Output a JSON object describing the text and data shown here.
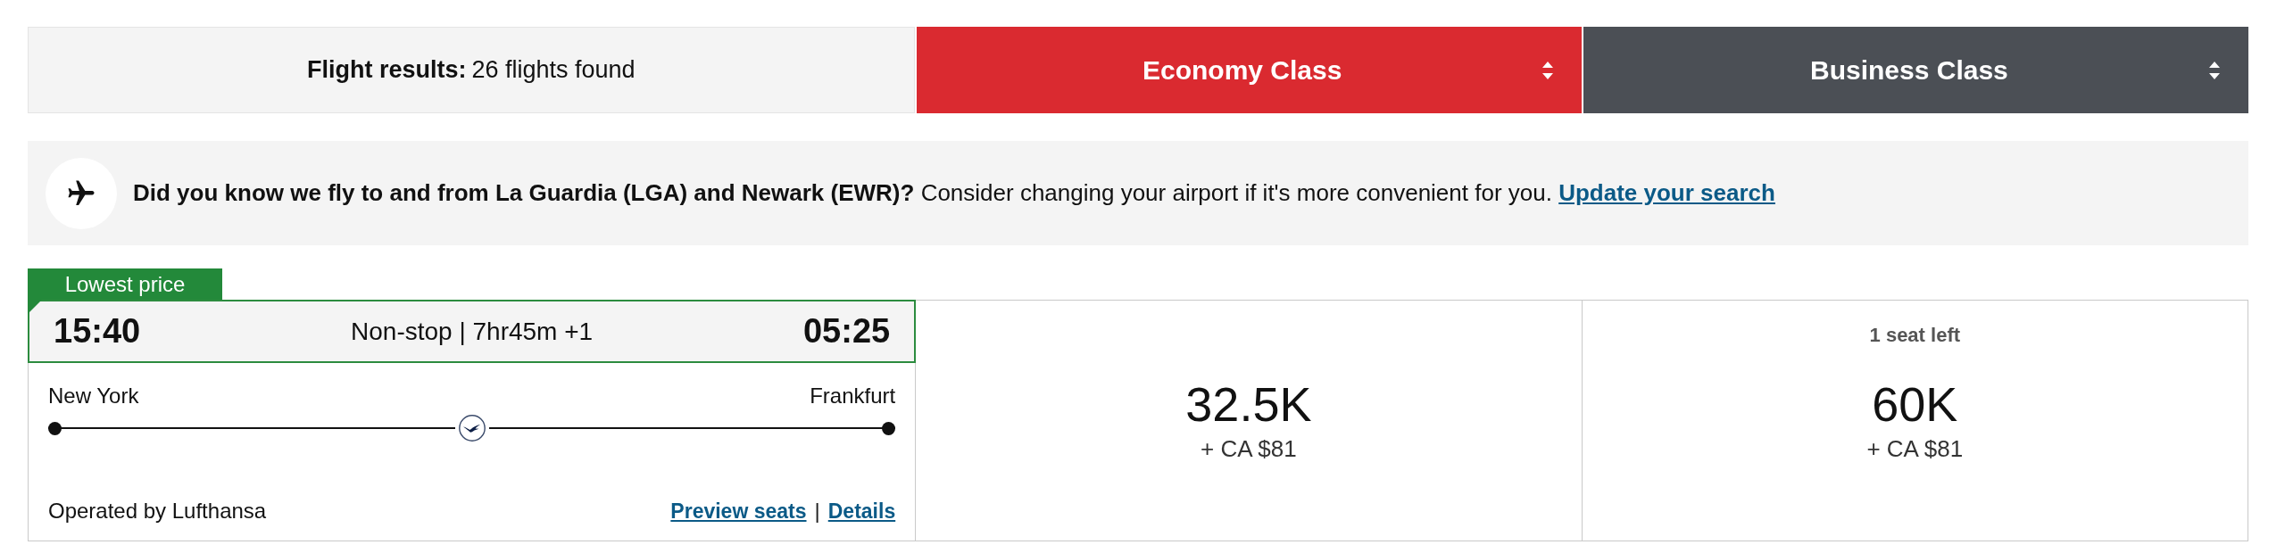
{
  "results_bar": {
    "text": "**Flight results:** 26 flights found"
  },
  "cabin_tabs": [
    {
      "label": "Economy Class",
      "selected": true
    },
    {
      "label": "Business Class",
      "selected": false
    }
  ],
  "notice": {
    "text": "**Did you know we fly to and from La Guardia (LGA) and Newark (EWR)?** Consider changing your airport if it's more convenient for you.",
    "link": "Update your search"
  },
  "flights": [
    {
      "badge": "Lowest price",
      "departure": "15:40",
      "summary": "Non-stop | 7hr45m +1",
      "arrival": "05:25",
      "origin": "New York",
      "destination": "Frankfurt",
      "operator": "Operated by Lufthansa",
      "links": [
        "Preview seats",
        "Details"
      ],
      "link_separator": "|",
      "fares": [
        {
          "price": "32.5K",
          "taxes": "+ CA $81"
        },
        {
          "seats_note": "1 seat left",
          "price": "60K",
          "taxes": "+ CA $81"
        }
      ]
    }
  ]
}
